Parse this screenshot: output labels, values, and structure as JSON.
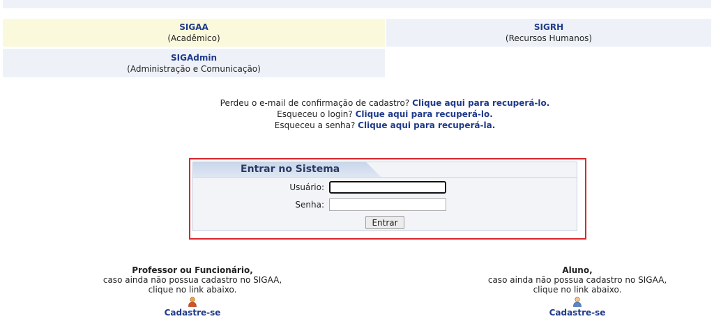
{
  "systems": [
    {
      "name": "SIGAA",
      "desc": "(Acadêmico)"
    },
    {
      "name": "SIGRH",
      "desc": "(Recursos Humanos)"
    },
    {
      "name": "SIGAdmin",
      "desc": "(Administração e Comunicação)"
    }
  ],
  "recovery": {
    "email_text": "Perdeu o e-mail de confirmação de cadastro?",
    "email_link": "Clique aqui para recuperá-lo.",
    "login_text": "Esqueceu o login?",
    "login_link": "Clique aqui para recuperá-lo.",
    "password_text": "Esqueceu a senha?",
    "password_link": "Clique aqui para recuperá-la."
  },
  "login": {
    "title": "Entrar no Sistema",
    "user_label": "Usuário:",
    "user_value": "",
    "pass_label": "Senha:",
    "pass_value": "",
    "submit_label": "Entrar"
  },
  "register": {
    "professor": {
      "title": "Professor ou Funcionário,",
      "line1": "caso ainda não possua cadastro no SIGAA,",
      "line2": "clique no link abaixo.",
      "icon": "person-orange-icon",
      "link": "Cadastre-se"
    },
    "aluno": {
      "title": "Aluno,",
      "line1": "caso ainda não possua cadastro no SIGAA,",
      "line2": "clique no link abaixo.",
      "icon": "person-blue-icon",
      "link": "Cadastre-se"
    }
  },
  "colors": {
    "link": "#1f3a8a",
    "highlight_border": "#d9262b",
    "sigaa_bg": "#fbf9dc",
    "panel_bg": "#eef2f8"
  }
}
